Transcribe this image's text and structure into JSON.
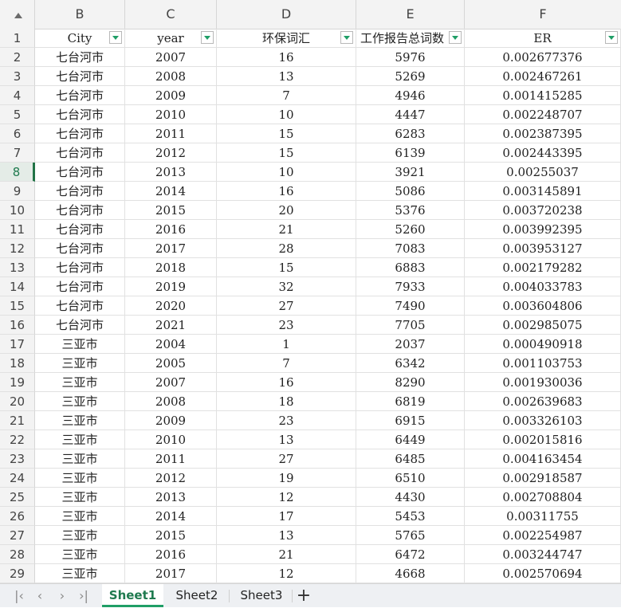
{
  "sheet": {
    "columns": [
      "B",
      "C",
      "D",
      "E",
      "F"
    ],
    "header_row_number": "1",
    "headers": [
      "City",
      "year",
      "环保词汇",
      "工作报告总词数",
      "ER"
    ],
    "active_row_number": "8",
    "rows": [
      {
        "n": "2",
        "city": "七台河市",
        "year": "2007",
        "eco": "16",
        "total": "5976",
        "er": "0.002677376"
      },
      {
        "n": "3",
        "city": "七台河市",
        "year": "2008",
        "eco": "13",
        "total": "5269",
        "er": "0.002467261"
      },
      {
        "n": "4",
        "city": "七台河市",
        "year": "2009",
        "eco": "7",
        "total": "4946",
        "er": "0.001415285"
      },
      {
        "n": "5",
        "city": "七台河市",
        "year": "2010",
        "eco": "10",
        "total": "4447",
        "er": "0.002248707"
      },
      {
        "n": "6",
        "city": "七台河市",
        "year": "2011",
        "eco": "15",
        "total": "6283",
        "er": "0.002387395"
      },
      {
        "n": "7",
        "city": "七台河市",
        "year": "2012",
        "eco": "15",
        "total": "6139",
        "er": "0.002443395"
      },
      {
        "n": "8",
        "city": "七台河市",
        "year": "2013",
        "eco": "10",
        "total": "3921",
        "er": "0.00255037"
      },
      {
        "n": "9",
        "city": "七台河市",
        "year": "2014",
        "eco": "16",
        "total": "5086",
        "er": "0.003145891"
      },
      {
        "n": "10",
        "city": "七台河市",
        "year": "2015",
        "eco": "20",
        "total": "5376",
        "er": "0.003720238"
      },
      {
        "n": "11",
        "city": "七台河市",
        "year": "2016",
        "eco": "21",
        "total": "5260",
        "er": "0.003992395"
      },
      {
        "n": "12",
        "city": "七台河市",
        "year": "2017",
        "eco": "28",
        "total": "7083",
        "er": "0.003953127"
      },
      {
        "n": "13",
        "city": "七台河市",
        "year": "2018",
        "eco": "15",
        "total": "6883",
        "er": "0.002179282"
      },
      {
        "n": "14",
        "city": "七台河市",
        "year": "2019",
        "eco": "32",
        "total": "7933",
        "er": "0.004033783"
      },
      {
        "n": "15",
        "city": "七台河市",
        "year": "2020",
        "eco": "27",
        "total": "7490",
        "er": "0.003604806"
      },
      {
        "n": "16",
        "city": "七台河市",
        "year": "2021",
        "eco": "23",
        "total": "7705",
        "er": "0.002985075"
      },
      {
        "n": "17",
        "city": "三亚市",
        "year": "2004",
        "eco": "1",
        "total": "2037",
        "er": "0.000490918"
      },
      {
        "n": "18",
        "city": "三亚市",
        "year": "2005",
        "eco": "7",
        "total": "6342",
        "er": "0.001103753"
      },
      {
        "n": "19",
        "city": "三亚市",
        "year": "2007",
        "eco": "16",
        "total": "8290",
        "er": "0.001930036"
      },
      {
        "n": "20",
        "city": "三亚市",
        "year": "2008",
        "eco": "18",
        "total": "6819",
        "er": "0.002639683"
      },
      {
        "n": "21",
        "city": "三亚市",
        "year": "2009",
        "eco": "23",
        "total": "6915",
        "er": "0.003326103"
      },
      {
        "n": "22",
        "city": "三亚市",
        "year": "2010",
        "eco": "13",
        "total": "6449",
        "er": "0.002015816"
      },
      {
        "n": "23",
        "city": "三亚市",
        "year": "2011",
        "eco": "27",
        "total": "6485",
        "er": "0.004163454"
      },
      {
        "n": "24",
        "city": "三亚市",
        "year": "2012",
        "eco": "19",
        "total": "6510",
        "er": "0.002918587"
      },
      {
        "n": "25",
        "city": "三亚市",
        "year": "2013",
        "eco": "12",
        "total": "4430",
        "er": "0.002708804"
      },
      {
        "n": "26",
        "city": "三亚市",
        "year": "2014",
        "eco": "17",
        "total": "5453",
        "er": "0.00311755"
      },
      {
        "n": "27",
        "city": "三亚市",
        "year": "2015",
        "eco": "13",
        "total": "5765",
        "er": "0.002254987"
      },
      {
        "n": "28",
        "city": "三亚市",
        "year": "2016",
        "eco": "21",
        "total": "6472",
        "er": "0.003244747"
      },
      {
        "n": "29",
        "city": "三亚市",
        "year": "2017",
        "eco": "12",
        "total": "4668",
        "er": "0.002570694"
      }
    ]
  },
  "tabs": {
    "nav": [
      "first-sheet-icon",
      "prev-sheet-icon",
      "next-sheet-icon",
      "last-sheet-icon"
    ],
    "items": [
      "Sheet1",
      "Sheet2",
      "Sheet3"
    ],
    "active": "Sheet1",
    "add_icon": "plus-icon"
  },
  "colors": {
    "accent": "#217346",
    "filter_arrow": "#1f9e66",
    "header_bg": "#f3f3f3"
  }
}
